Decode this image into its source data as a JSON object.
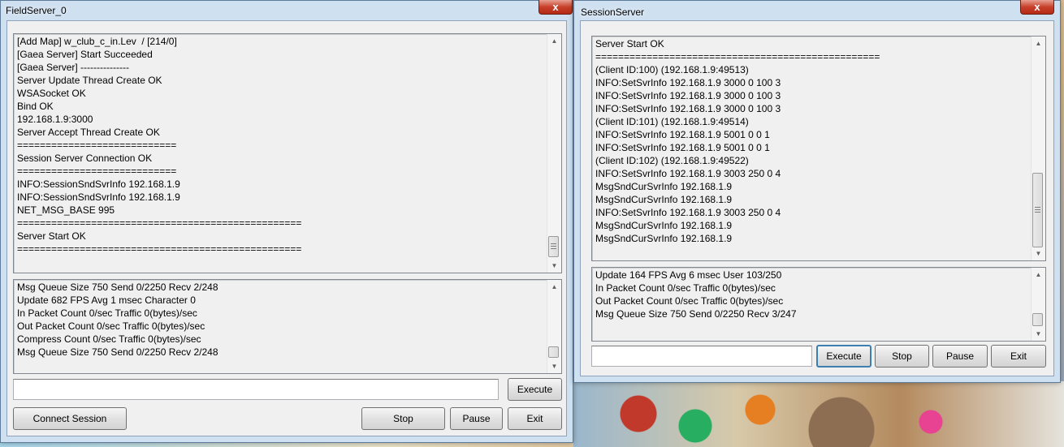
{
  "field_window": {
    "title": "FieldServer_0",
    "close_glyph": "x",
    "log_lines": [
      "[Add Map] w_club_c_in.Lev  / [214/0]",
      "[Gaea Server] Start Succeeded",
      "[Gaea Server] ---------------",
      "Server Update Thread Create OK",
      "WSASocket OK",
      "Bind OK",
      "192.168.1.9:3000",
      "Server Accept Thread Create OK",
      "============================",
      "Session Server Connection OK",
      "============================",
      "INFO:SessionSndSvrInfo 192.168.1.9",
      "INFO:SessionSndSvrInfo 192.168.1.9",
      "NET_MSG_BASE 995",
      "==================================================",
      "Server Start OK",
      "=================================================="
    ],
    "stats_lines": [
      "Msg Queue Size 750 Send 0/2250 Recv 2/248",
      "Update 682 FPS Avg 1 msec Character 0",
      "In Packet Count 0/sec Traffic 0(bytes)/sec",
      "Out Packet Count 0/sec Traffic 0(bytes)/sec",
      "Compress Count 0/sec Traffic 0(bytes)/sec",
      "Msg Queue Size 750 Send 0/2250 Recv 2/248"
    ],
    "command_value": "",
    "execute_label": "Execute",
    "connect_session_label": "Connect Session",
    "stop_label": "Stop",
    "pause_label": "Pause",
    "exit_label": "Exit"
  },
  "session_window": {
    "title": "SessionServer",
    "close_glyph": "x",
    "log_lines": [
      "Server Start OK",
      "==================================================",
      "(Client ID:100) (192.168.1.9:49513)",
      "INFO:SetSvrInfo 192.168.1.9 3000 0 100 3",
      "INFO:SetSvrInfo 192.168.1.9 3000 0 100 3",
      "INFO:SetSvrInfo 192.168.1.9 3000 0 100 3",
      "(Client ID:101) (192.168.1.9:49514)",
      "INFO:SetSvrInfo 192.168.1.9 5001 0 0 1",
      "INFO:SetSvrInfo 192.168.1.9 5001 0 0 1",
      "(Client ID:102) (192.168.1.9:49522)",
      "INFO:SetSvrInfo 192.168.1.9 3003 250 0 4",
      "MsgSndCurSvrInfo 192.168.1.9",
      "MsgSndCurSvrInfo 192.168.1.9",
      "INFO:SetSvrInfo 192.168.1.9 3003 250 0 4",
      "MsgSndCurSvrInfo 192.168.1.9",
      "MsgSndCurSvrInfo 192.168.1.9"
    ],
    "stats_lines": [
      "Update 164 FPS Avg 6 msec User 103/250",
      "In Packet Count 0/sec Traffic 0(bytes)/sec",
      "Out Packet Count 0/sec Traffic 0(bytes)/sec",
      "Msg Queue Size 750 Send 0/2250 Recv 3/247"
    ],
    "command_value": "",
    "execute_label": "Execute",
    "stop_label": "Stop",
    "pause_label": "Pause",
    "exit_label": "Exit"
  },
  "icons": {
    "scroll_up": "▲",
    "scroll_down": "▼"
  }
}
